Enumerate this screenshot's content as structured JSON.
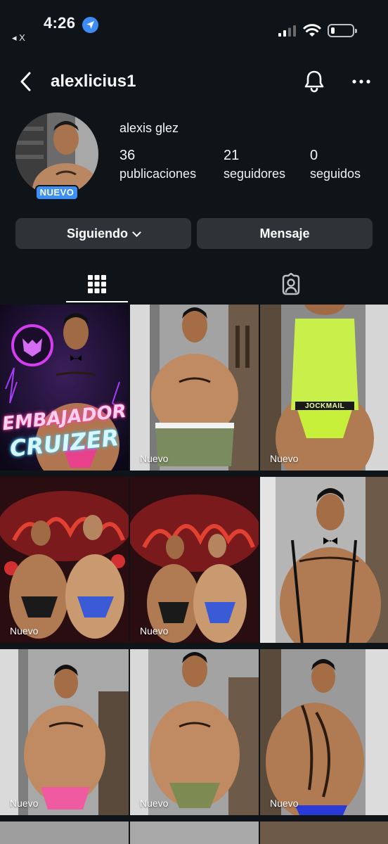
{
  "status_bar": {
    "time": "4:26",
    "back_app": "◂ X"
  },
  "header": {
    "username": "alexlicius1"
  },
  "profile": {
    "full_name": "alexis glez",
    "badge": "NUEVO",
    "stats": [
      {
        "value": "36",
        "label": "publicaciones"
      },
      {
        "value": "21",
        "label": "seguidores"
      },
      {
        "value": "0",
        "label": "seguidos"
      }
    ]
  },
  "actions": {
    "following": "Siguiendo",
    "message": "Mensaje"
  },
  "tabs": {
    "active": "posts-grid"
  },
  "grid": {
    "first_post": {
      "line1": "EMBAJADOR",
      "line2": "CRUIZER"
    },
    "new_label": "Nuevo",
    "brand_text": "JOCKMAIL"
  },
  "colors": {
    "background": "#0f1419",
    "button_bg": "#2f3338",
    "badge": "#3b8ff5",
    "location": "#3d8cf5"
  }
}
